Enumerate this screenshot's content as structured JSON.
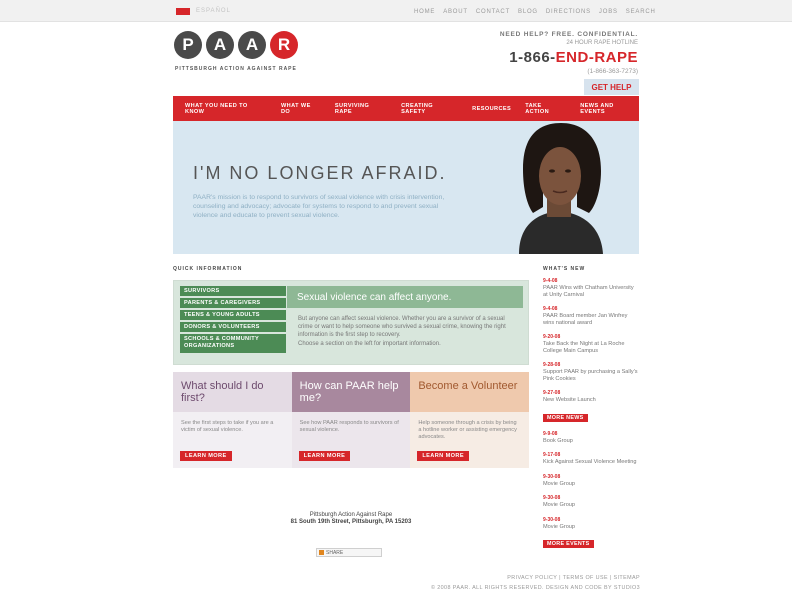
{
  "topbar": {
    "language_label": "ESPAÑOL",
    "nav": [
      "HOME",
      "ABOUT",
      "CONTACT",
      "BLOG",
      "DIRECTIONS",
      "JOBS",
      "SEARCH"
    ]
  },
  "logo": {
    "letters": [
      "P",
      "A",
      "A",
      "R"
    ],
    "subtitle": "PITTSBURGH ACTION AGAINST RAPE"
  },
  "help": {
    "need_help": "NEED HELP? FREE. CONFIDENTIAL.",
    "hotline": "24 HOUR RAPE HOTLINE",
    "phone_prefix": "1-866-",
    "phone_highlight": "END-RAPE",
    "phone_alt": "(1-866-363-7273)",
    "get_help": "GET HELP"
  },
  "main_nav": [
    "WHAT YOU NEED TO KNOW",
    "WHAT WE DO",
    "SURVIVING RAPE",
    "CREATING SAFETY",
    "RESOURCES",
    "TAKE ACTION",
    "NEWS AND EVENTS"
  ],
  "hero": {
    "headline": "I'M NO LONGER AFRAID.",
    "mission": "PAAR's mission is to respond to survivors of sexual violence with crisis intervention, counseling and advocacy; advocate for systems to respond to and prevent sexual violence and educate to prevent sexual violence."
  },
  "quick_info": {
    "label": "QUICK INFORMATION",
    "menu": [
      "SURVIVORS",
      "PARENTS & CAREGIVERS",
      "TEENS & YOUNG ADULTS",
      "DONORS & VOLUNTEERS",
      "SCHOOLS & COMMUNITY ORGANIZATIONS"
    ],
    "heading": "Sexual violence can affect anyone.",
    "body": "But anyone can affect sexual violence. Whether you are a survivor of a sexual crime or want to help someone who survived a sexual crime, knowing the right information is the first step to recovery.",
    "body2": "Choose a section on the left for important information."
  },
  "ctas": [
    {
      "title": "What should I do first?",
      "text": "See the first steps to take if you are a victim of sexual violence.",
      "button": "LEARN MORE"
    },
    {
      "title": "How can PAAR help me?",
      "text": "See how PAAR responds to survivors of sexual violence.",
      "button": "LEARN MORE"
    },
    {
      "title": "Become a Volunteer",
      "text": "Help someone through a crisis by being a hotline worker or assisting emergency advocates.",
      "button": "LEARN MORE"
    }
  ],
  "news": {
    "label": "WHAT'S NEW",
    "items": [
      {
        "date": "9-4-08",
        "title": "PAAR Wins with Chatham University at Unity Carnival"
      },
      {
        "date": "9-4-08",
        "title": "PAAR Board member Jan Winfrey wins national award"
      },
      {
        "date": "9-20-08",
        "title": "Take Back the Night at La Roche College Main Campus"
      },
      {
        "date": "9-28-08",
        "title": "Support PAAR by purchasing a Sally's Pink Cookies"
      },
      {
        "date": "9-27-08",
        "title": "New Website Launch"
      }
    ],
    "more_news": "MORE NEWS",
    "events": [
      {
        "date": "9-9-08",
        "title": "Book Group"
      },
      {
        "date": "9-17-08",
        "title": "Kick Against Sexual Violence Meeting"
      },
      {
        "date": "9-30-08",
        "title": "Movie Group"
      },
      {
        "date": "9-30-08",
        "title": "Movie Group"
      },
      {
        "date": "9-30-08",
        "title": "Movie Group"
      }
    ],
    "more_events": "MORE EVENTS"
  },
  "footer": {
    "org": "Pittsburgh Action Against Rape",
    "address": "81 South 19th Street, Pittsburgh, PA 15203",
    "share": "SHARE",
    "links": "PRIVACY POLICY | TERMS OF USE | SITEMAP",
    "copyright": "© 2008 PAAR. ALL RIGHTS RESERVED. DESIGN AND CODE BY STUDIO3"
  },
  "colors": {
    "brand_red": "#d6262a",
    "green": "#4c8b55",
    "hero_blue": "#d8e7f1"
  }
}
